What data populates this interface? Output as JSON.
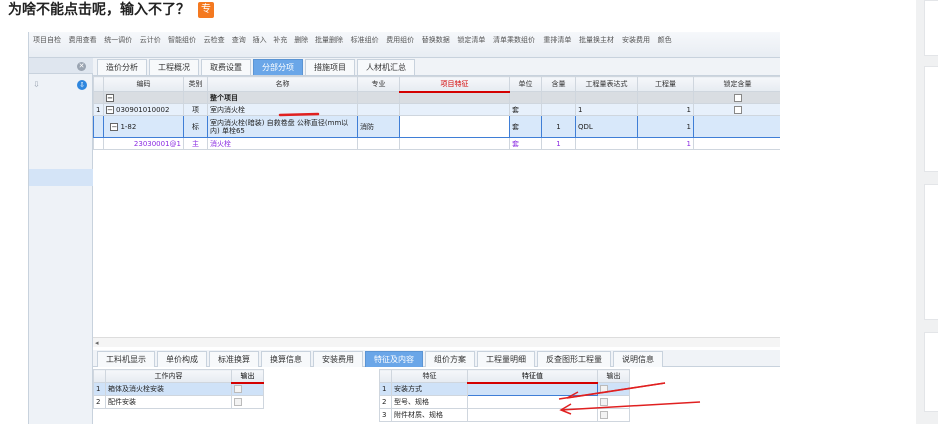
{
  "post": {
    "title": "为啥不能点击呢，输入不了？",
    "badge": "专"
  },
  "ribbon": {
    "items": [
      "项目自检",
      "费用查看",
      "统一调价",
      "云计价",
      "智能组价",
      "云检查",
      "查询",
      "插入",
      "补充",
      "删除",
      "批量删除",
      "标准组价",
      "费用组价",
      "替换数据",
      "锁定清单",
      "清单乘数组价",
      "重排清单",
      "批量换主材",
      "安装费用",
      "颜色"
    ]
  },
  "leftpane": {
    "close_icon": "✕",
    "pin_icon": "⇩",
    "down_icon": "⇩"
  },
  "tabs_top": [
    {
      "label": "造价分析",
      "active": false
    },
    {
      "label": "工程概况",
      "active": false
    },
    {
      "label": "取费设置",
      "active": false
    },
    {
      "label": "分部分项",
      "active": true
    },
    {
      "label": "措施项目",
      "active": false
    },
    {
      "label": "人材机汇总",
      "active": false
    }
  ],
  "grid": {
    "headers": [
      "",
      "编码",
      "类别",
      "名称",
      "专业",
      "项目特征",
      "单位",
      "含量",
      "工程量表达式",
      "工程量",
      "锁定含量"
    ],
    "rows": [
      {
        "idx": "",
        "code": "",
        "type": "",
        "name": "整个项目",
        "major": "",
        "feature": "",
        "unit": "",
        "qty_ratio": "",
        "expr": "",
        "qty": "",
        "lock": "box"
      },
      {
        "idx": "1",
        "code": "030901010002",
        "type": "项",
        "name": "室内消火栓",
        "major": "",
        "feature": "",
        "unit": "套",
        "qty_ratio": "",
        "expr": "1",
        "qty": "1",
        "lock": "box"
      },
      {
        "idx": "",
        "code": "1-82",
        "type": "标",
        "name": "室内消火栓(暗装) 自救卷盘 公称直径(mm以内) 单栓65",
        "major": "消防",
        "feature": "",
        "unit": "套",
        "qty_ratio": "1",
        "expr": "QDL",
        "qty": "1",
        "lock": ""
      },
      {
        "idx": "",
        "code": "23030001@1",
        "type": "主",
        "name": "消火栓",
        "major": "",
        "feature": "",
        "unit": "套",
        "qty_ratio": "1",
        "expr": "",
        "qty": "1",
        "lock": ""
      }
    ]
  },
  "tabs_bottom": [
    {
      "label": "工料机显示",
      "active": false
    },
    {
      "label": "单价构成",
      "active": false
    },
    {
      "label": "标准换算",
      "active": false
    },
    {
      "label": "换算信息",
      "active": false
    },
    {
      "label": "安装费用",
      "active": false
    },
    {
      "label": "特征及内容",
      "active": true
    },
    {
      "label": "组价方案",
      "active": false
    },
    {
      "label": "工程量明细",
      "active": false
    },
    {
      "label": "反查图形工程量",
      "active": false
    },
    {
      "label": "说明信息",
      "active": false
    }
  ],
  "work_content": {
    "headers": [
      "",
      "工作内容",
      "输出"
    ],
    "rows": [
      {
        "idx": "1",
        "text": "箱体及消火栓安装"
      },
      {
        "idx": "2",
        "text": "配件安装"
      }
    ]
  },
  "features": {
    "headers": [
      "",
      "特征",
      "特征值",
      "输出"
    ],
    "rows": [
      {
        "idx": "1",
        "name": "安装方式",
        "value": ""
      },
      {
        "idx": "2",
        "name": "型号、规格",
        "value": ""
      },
      {
        "idx": "3",
        "name": "附件材质、规格",
        "value": ""
      }
    ]
  },
  "colors": {
    "accent": "#6aa6e8",
    "annotation": "#e02020",
    "badge": "#f47920"
  }
}
